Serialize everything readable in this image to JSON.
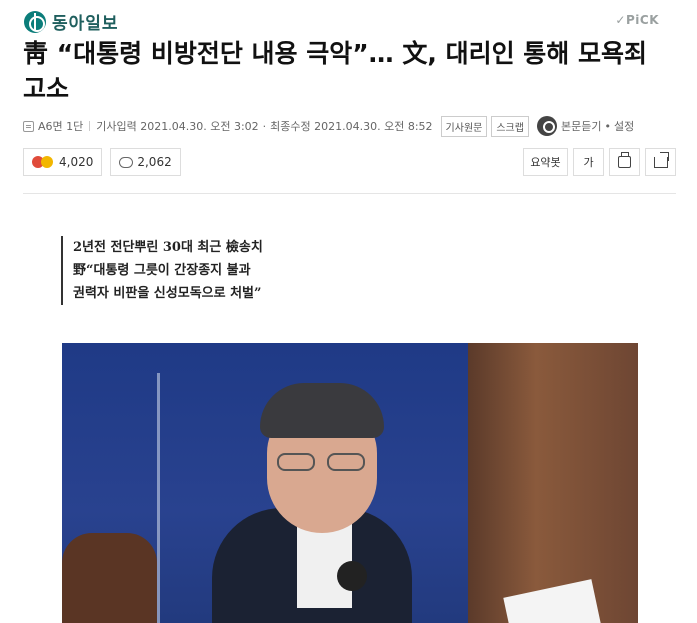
{
  "header": {
    "logo_text": "동아일보",
    "pick_label": "✓PiCK"
  },
  "article": {
    "title": "靑 “대통령 비방전단 내용 극악”… 文, 대리인 통해 모욕죄 고소",
    "meta": {
      "page": "A6면 1단",
      "published": "기사입력 2021.04.30. 오전 3:02",
      "modified": "최종수정 2021.04.30. 오전 8:52",
      "original_btn": "기사원문",
      "scrap_btn": "스크랩",
      "listen_label": "본문듣기",
      "settings_label": "설정"
    },
    "reactions": {
      "emotion_count": "4,020",
      "comment_count": "2,062"
    },
    "tools": {
      "summary_label": "요약봇",
      "font_label": "가"
    },
    "subhead": [
      "2년전 전단뿌린 30대 최근 檢송치",
      "野“대통령 그릇이 간장종지 불과",
      "권력자 비판을 신성모독으로 처벌”"
    ]
  }
}
